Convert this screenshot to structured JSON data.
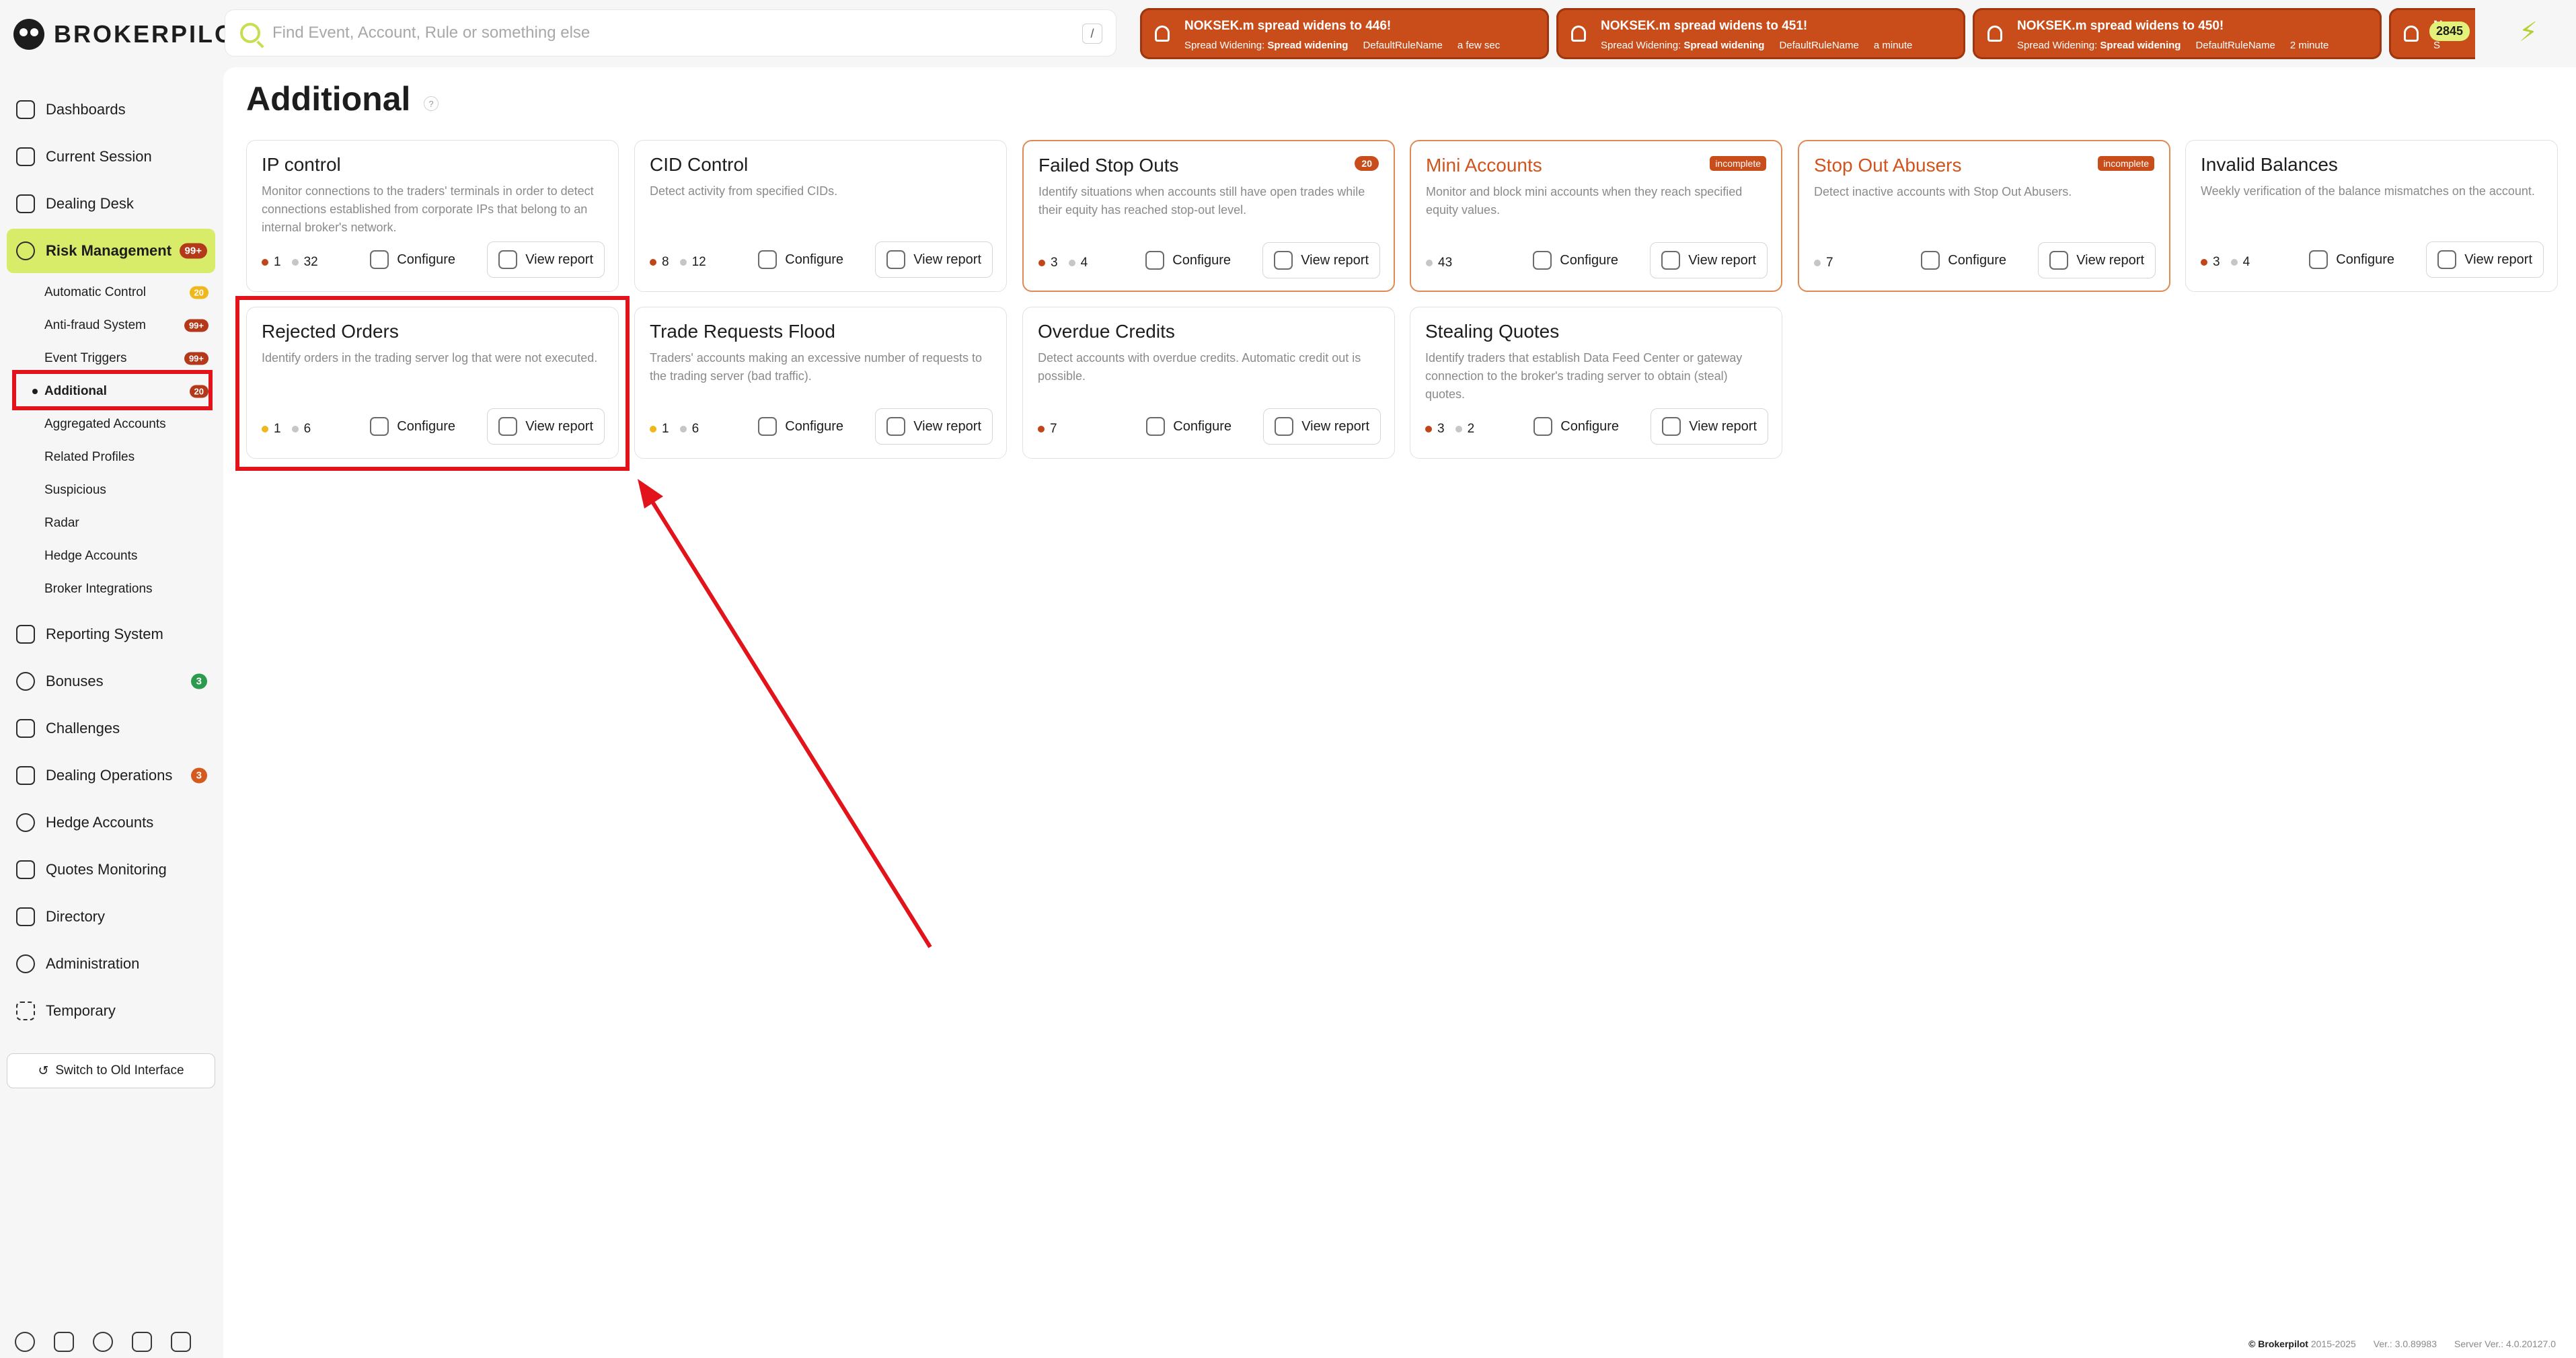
{
  "brand": {
    "name": "BROKERPILOT"
  },
  "search": {
    "placeholder": "Find Event, Account, Rule or something else",
    "shortcut": "/"
  },
  "alerts": [
    {
      "title": "NOKSEK.m spread widens to 446!",
      "type": "Spread Widening:",
      "type_value": "Spread widening",
      "rule": "DefaultRuleName",
      "time": "a few sec"
    },
    {
      "title": "NOKSEK.m spread widens to 451!",
      "type": "Spread Widening:",
      "type_value": "Spread widening",
      "rule": "DefaultRuleName",
      "time": "a minute"
    },
    {
      "title": "NOKSEK.m spread widens to 450!",
      "type": "Spread Widening:",
      "type_value": "Spread widening",
      "rule": "DefaultRuleName",
      "time": "2 minute"
    },
    {
      "title": "N",
      "type": "S",
      "type_value": "",
      "rule": "",
      "time": ""
    }
  ],
  "alert_count": "2845",
  "sidebar": {
    "items": [
      {
        "label": "Dashboards",
        "icon": "dashboard-icon"
      },
      {
        "label": "Current Session",
        "icon": "session-icon"
      },
      {
        "label": "Dealing Desk",
        "icon": "desk-icon"
      },
      {
        "label": "Risk Management",
        "icon": "risk-icon",
        "badge": "99+"
      },
      {
        "label": "Reporting System",
        "icon": "report-icon"
      },
      {
        "label": "Bonuses",
        "icon": "bonus-icon",
        "badge": "3"
      },
      {
        "label": "Challenges",
        "icon": "flag-icon"
      },
      {
        "label": "Dealing Operations",
        "icon": "operations-icon",
        "badge": "3"
      },
      {
        "label": "Hedge Accounts",
        "icon": "hedge-icon"
      },
      {
        "label": "Quotes Monitoring",
        "icon": "quotes-icon"
      },
      {
        "label": "Directory",
        "icon": "directory-icon"
      },
      {
        "label": "Administration",
        "icon": "admin-icon"
      },
      {
        "label": "Temporary",
        "icon": "temporary-icon"
      }
    ],
    "sub_items": [
      {
        "label": "Automatic Control",
        "badge": "20"
      },
      {
        "label": "Anti-fraud System",
        "badge": "99+"
      },
      {
        "label": "Event Triggers",
        "badge": "99+"
      },
      {
        "label": "Additional",
        "badge": "20"
      },
      {
        "label": "Aggregated Accounts"
      },
      {
        "label": "Related Profiles"
      },
      {
        "label": "Suspicious"
      },
      {
        "label": "Radar"
      },
      {
        "label": "Hedge Accounts"
      },
      {
        "label": "Broker Integrations"
      }
    ],
    "switch_label": "Switch to Old Interface"
  },
  "page": {
    "title": "Additional",
    "help": "?"
  },
  "buttons": {
    "configure": "Configure",
    "view_report": "View report"
  },
  "cards": [
    {
      "title": "IP control",
      "desc": "Monitor connections to the traders' terminals in order to detect connections established from corporate IPs that belong to an internal broker's network.",
      "stats": [
        {
          "color": "red",
          "value": "1"
        },
        {
          "color": "grey",
          "value": "32"
        }
      ]
    },
    {
      "title": "CID Control",
      "desc": "Detect activity from specified CIDs.",
      "stats": [
        {
          "color": "red",
          "value": "8"
        },
        {
          "color": "grey",
          "value": "12"
        }
      ]
    },
    {
      "title": "Failed Stop Outs",
      "desc": "Identify situations when accounts still have open trades while their equity has reached stop-out level.",
      "tag": "20",
      "stats": [
        {
          "color": "red",
          "value": "3"
        },
        {
          "color": "grey",
          "value": "4"
        }
      ]
    },
    {
      "title": "Mini Accounts",
      "desc": "Monitor and block mini accounts when they reach specified equity values.",
      "tag": "incomplete",
      "stats": [
        {
          "color": "grey",
          "value": "43"
        }
      ]
    },
    {
      "title": "Stop Out Abusers",
      "desc": "Detect inactive accounts with Stop Out Abusers.",
      "tag": "incomplete",
      "stats": [
        {
          "color": "grey",
          "value": "7"
        }
      ]
    },
    {
      "title": "Invalid Balances",
      "desc": "Weekly verification of the balance mismatches on the account.",
      "stats": [
        {
          "color": "red",
          "value": "3"
        },
        {
          "color": "grey",
          "value": "4"
        }
      ]
    },
    {
      "title": "Rejected Orders",
      "desc": "Identify orders in the trading server log that were not executed.",
      "stats": [
        {
          "color": "yellow",
          "value": "1"
        },
        {
          "color": "grey",
          "value": "6"
        }
      ]
    },
    {
      "title": "Trade Requests Flood",
      "desc": "Traders' accounts making an excessive number of requests to the trading server (bad traffic).",
      "stats": [
        {
          "color": "yellow",
          "value": "1"
        },
        {
          "color": "grey",
          "value": "6"
        }
      ]
    },
    {
      "title": "Overdue Credits",
      "desc": "Detect accounts with overdue credits. Automatic credit out is possible.",
      "stats": [
        {
          "color": "red",
          "value": "7"
        }
      ]
    },
    {
      "title": "Stealing Quotes",
      "desc": "Identify traders that establish Data Feed Center or gateway connection to the broker's trading server to obtain (steal) quotes.",
      "stats": [
        {
          "color": "red",
          "value": "3"
        },
        {
          "color": "grey",
          "value": "2"
        }
      ]
    }
  ],
  "footer": {
    "brand": "© Brokerpilot",
    "years": "2015-2025",
    "version": "Ver.: 3.0.89983",
    "server": "Server Ver.: 4.0.20127.0"
  },
  "colors": {
    "accent": "#d8ec6a",
    "alert": "#c84d1a",
    "annotation": "#e3131b"
  }
}
